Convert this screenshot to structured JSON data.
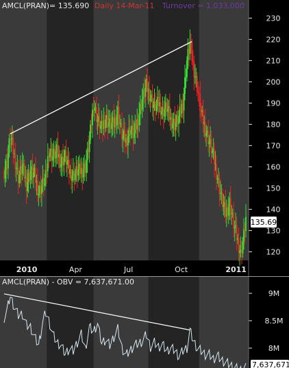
{
  "header": {
    "symbol_label": "AMCL(PRAN)= 135.690",
    "period_label": "Daily 14-Mar-11",
    "turnover_label": "Turnover = 1,033,000"
  },
  "obv_header": {
    "label": "AMCL(PRAN) - OBV = 7,637,671.00"
  },
  "colors": {
    "background": "#000000",
    "band_light": "#3a3a3a",
    "band_dark": "#242424",
    "up": "#33dd33",
    "down": "#ee2222",
    "trendline": "#ffffff",
    "obv_line": "#d8e8f0",
    "text": "#e8e8e8",
    "header_period": "#cc3333",
    "header_turnover": "#6a3ba0",
    "badge_bg": "#ffffff",
    "badge_text": "#000000"
  },
  "chart_data": [
    {
      "type": "candlestick",
      "title": "AMCL(PRAN)",
      "ylim": [
        114,
        234
      ],
      "y_ticks": [
        120,
        130,
        140,
        150,
        160,
        170,
        180,
        190,
        200,
        210,
        220,
        230
      ],
      "x_tick_labels": [
        "2010",
        "Apr",
        "Jul",
        "Oct",
        "2011"
      ],
      "last_price_label": "135.69",
      "grid": false,
      "series": [
        {
          "name": "AMCL(PRAN)",
          "points": [
            {
              "x": 0,
              "y": 158
            },
            {
              "x": 3,
              "y": 162
            },
            {
              "x": 6,
              "y": 175
            },
            {
              "x": 10,
              "y": 165
            },
            {
              "x": 14,
              "y": 155
            },
            {
              "x": 18,
              "y": 160
            },
            {
              "x": 22,
              "y": 152
            },
            {
              "x": 26,
              "y": 158
            },
            {
              "x": 30,
              "y": 156
            },
            {
              "x": 34,
              "y": 148
            },
            {
              "x": 38,
              "y": 152
            },
            {
              "x": 41,
              "y": 155
            },
            {
              "x": 44,
              "y": 168
            },
            {
              "x": 48,
              "y": 165
            },
            {
              "x": 52,
              "y": 167
            },
            {
              "x": 56,
              "y": 162
            },
            {
              "x": 60,
              "y": 165
            },
            {
              "x": 64,
              "y": 158
            },
            {
              "x": 68,
              "y": 156
            },
            {
              "x": 72,
              "y": 158
            },
            {
              "x": 76,
              "y": 158
            },
            {
              "x": 80,
              "y": 160
            },
            {
              "x": 84,
              "y": 172
            },
            {
              "x": 88,
              "y": 190
            },
            {
              "x": 92,
              "y": 182
            },
            {
              "x": 96,
              "y": 178
            },
            {
              "x": 100,
              "y": 183
            },
            {
              "x": 104,
              "y": 180
            },
            {
              "x": 108,
              "y": 180
            },
            {
              "x": 112,
              "y": 186
            },
            {
              "x": 116,
              "y": 175
            },
            {
              "x": 120,
              "y": 172
            },
            {
              "x": 124,
              "y": 178
            },
            {
              "x": 128,
              "y": 175
            },
            {
              "x": 132,
              "y": 183
            },
            {
              "x": 136,
              "y": 192
            },
            {
              "x": 140,
              "y": 198
            },
            {
              "x": 144,
              "y": 193
            },
            {
              "x": 148,
              "y": 188
            },
            {
              "x": 152,
              "y": 190
            },
            {
              "x": 156,
              "y": 186
            },
            {
              "x": 160,
              "y": 188
            },
            {
              "x": 164,
              "y": 182
            },
            {
              "x": 168,
              "y": 180
            },
            {
              "x": 172,
              "y": 183
            },
            {
              "x": 176,
              "y": 190
            },
            {
              "x": 180,
              "y": 210
            },
            {
              "x": 183,
              "y": 218
            },
            {
              "x": 186,
              "y": 208
            },
            {
              "x": 190,
              "y": 198
            },
            {
              "x": 194,
              "y": 185
            },
            {
              "x": 198,
              "y": 178
            },
            {
              "x": 202,
              "y": 172
            },
            {
              "x": 206,
              "y": 165
            },
            {
              "x": 210,
              "y": 155
            },
            {
              "x": 214,
              "y": 145
            },
            {
              "x": 218,
              "y": 138
            },
            {
              "x": 222,
              "y": 143
            },
            {
              "x": 226,
              "y": 133
            },
            {
              "x": 230,
              "y": 125
            },
            {
              "x": 233,
              "y": 119
            },
            {
              "x": 236,
              "y": 128
            },
            {
              "x": 238,
              "y": 135.69
            }
          ]
        }
      ],
      "annotations": [
        {
          "type": "trendline",
          "from": {
            "x": 6,
            "y": 175.5
          },
          "to": {
            "x": 185,
            "y": 219
          }
        }
      ]
    },
    {
      "type": "line",
      "title": "AMCL(PRAN) - OBV",
      "ylim": [
        7600000,
        9100000
      ],
      "y_tick_values": [
        8000000,
        8500000,
        9000000
      ],
      "y_tick_labels": [
        "8M",
        "8.5M",
        "9M"
      ],
      "last_value_label": "7,637,671",
      "grid": false,
      "series": [
        {
          "name": "OBV",
          "points": [
            {
              "x": 0,
              "y": 8550000
            },
            {
              "x": 3,
              "y": 8700000
            },
            {
              "x": 6,
              "y": 8950000
            },
            {
              "x": 10,
              "y": 8750000
            },
            {
              "x": 14,
              "y": 8600000
            },
            {
              "x": 18,
              "y": 8620000
            },
            {
              "x": 22,
              "y": 8420000
            },
            {
              "x": 26,
              "y": 8380000
            },
            {
              "x": 30,
              "y": 8200000
            },
            {
              "x": 34,
              "y": 8050000
            },
            {
              "x": 38,
              "y": 8480000
            },
            {
              "x": 41,
              "y": 8650000
            },
            {
              "x": 44,
              "y": 8500000
            },
            {
              "x": 48,
              "y": 8250000
            },
            {
              "x": 52,
              "y": 8100000
            },
            {
              "x": 56,
              "y": 8050000
            },
            {
              "x": 60,
              "y": 7900000
            },
            {
              "x": 64,
              "y": 7980000
            },
            {
              "x": 68,
              "y": 7950000
            },
            {
              "x": 72,
              "y": 8100000
            },
            {
              "x": 76,
              "y": 8250000
            },
            {
              "x": 80,
              "y": 7980000
            },
            {
              "x": 84,
              "y": 8380000
            },
            {
              "x": 88,
              "y": 8300000
            },
            {
              "x": 92,
              "y": 8450000
            },
            {
              "x": 96,
              "y": 8100000
            },
            {
              "x": 100,
              "y": 8150000
            },
            {
              "x": 104,
              "y": 8050000
            },
            {
              "x": 108,
              "y": 8200000
            },
            {
              "x": 112,
              "y": 8350000
            },
            {
              "x": 116,
              "y": 8000000
            },
            {
              "x": 120,
              "y": 7870000
            },
            {
              "x": 124,
              "y": 7950000
            },
            {
              "x": 128,
              "y": 8050000
            },
            {
              "x": 132,
              "y": 8080000
            },
            {
              "x": 136,
              "y": 8120000
            },
            {
              "x": 140,
              "y": 8250000
            },
            {
              "x": 144,
              "y": 8020000
            },
            {
              "x": 148,
              "y": 8100000
            },
            {
              "x": 152,
              "y": 8020000
            },
            {
              "x": 156,
              "y": 8060000
            },
            {
              "x": 160,
              "y": 7950000
            },
            {
              "x": 164,
              "y": 8000000
            },
            {
              "x": 168,
              "y": 7960000
            },
            {
              "x": 172,
              "y": 7850000
            },
            {
              "x": 176,
              "y": 7950000
            },
            {
              "x": 180,
              "y": 8000000
            },
            {
              "x": 183,
              "y": 8320000
            },
            {
              "x": 186,
              "y": 8150000
            },
            {
              "x": 190,
              "y": 8000000
            },
            {
              "x": 194,
              "y": 7950000
            },
            {
              "x": 198,
              "y": 7880000
            },
            {
              "x": 202,
              "y": 7880000
            },
            {
              "x": 206,
              "y": 7800000
            },
            {
              "x": 210,
              "y": 7860000
            },
            {
              "x": 214,
              "y": 7780000
            },
            {
              "x": 218,
              "y": 7740000
            },
            {
              "x": 222,
              "y": 7700000
            },
            {
              "x": 226,
              "y": 7650000
            },
            {
              "x": 230,
              "y": 7620000
            },
            {
              "x": 233,
              "y": 7600000
            },
            {
              "x": 236,
              "y": 7630000
            },
            {
              "x": 238,
              "y": 7637671
            }
          ]
        }
      ],
      "annotations": [
        {
          "type": "trendline",
          "from": {
            "x": 0,
            "y": 8990000
          },
          "to": {
            "x": 183,
            "y": 8330000
          }
        }
      ]
    }
  ]
}
